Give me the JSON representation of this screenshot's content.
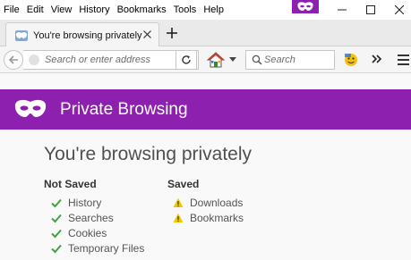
{
  "menubar": {
    "items": [
      "File",
      "Edit",
      "View",
      "History",
      "Bookmarks",
      "Tools",
      "Help"
    ]
  },
  "tab": {
    "title": "You're browsing privately"
  },
  "toolbar": {
    "url_placeholder": "Search or enter address",
    "search_placeholder": "Search"
  },
  "banner": {
    "title": "Private Browsing"
  },
  "main": {
    "heading": "You're browsing privately",
    "not_saved": {
      "title": "Not Saved",
      "items": [
        "History",
        "Searches",
        "Cookies",
        "Temporary Files"
      ]
    },
    "saved": {
      "title": "Saved",
      "items": [
        "Downloads",
        "Bookmarks"
      ]
    }
  },
  "colors": {
    "private_purple": "#8d20ae",
    "check_green": "#43a047",
    "warning_yellow": "#f0c600"
  },
  "icons": {
    "not_saved_item": "checkmark-icon",
    "saved_item": "warning-icon",
    "banner": "private-mask-icon"
  }
}
